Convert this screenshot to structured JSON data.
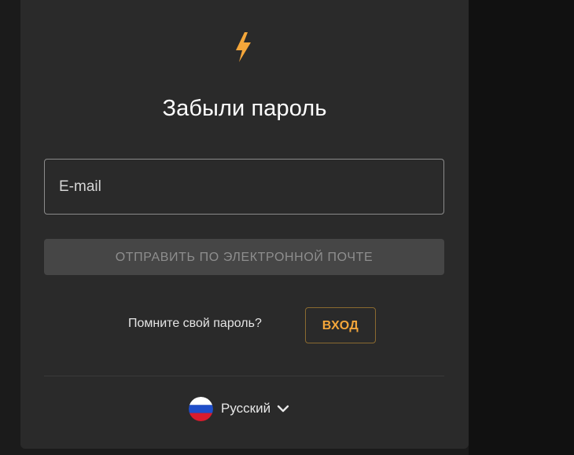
{
  "form": {
    "title": "Забыли пароль",
    "email_placeholder": "E-mail",
    "send_button_label": "ОТПРАВИТЬ ПО ЭЛЕКТРОННОЙ ПОЧТЕ",
    "remember_prompt": "Помните свой пароль?",
    "login_button_label": "ВХОД"
  },
  "language": {
    "selected": "Русский",
    "flag_icon": "russia-flag-icon",
    "chevron_icon": "chevron-down-icon"
  },
  "colors": {
    "accent": "#f4a63a",
    "card_background": "#2a2a2a",
    "page_background": "#1b1b1b",
    "disabled_button": "#464646"
  },
  "icons": {
    "logo": "lightning-bolt-icon"
  }
}
